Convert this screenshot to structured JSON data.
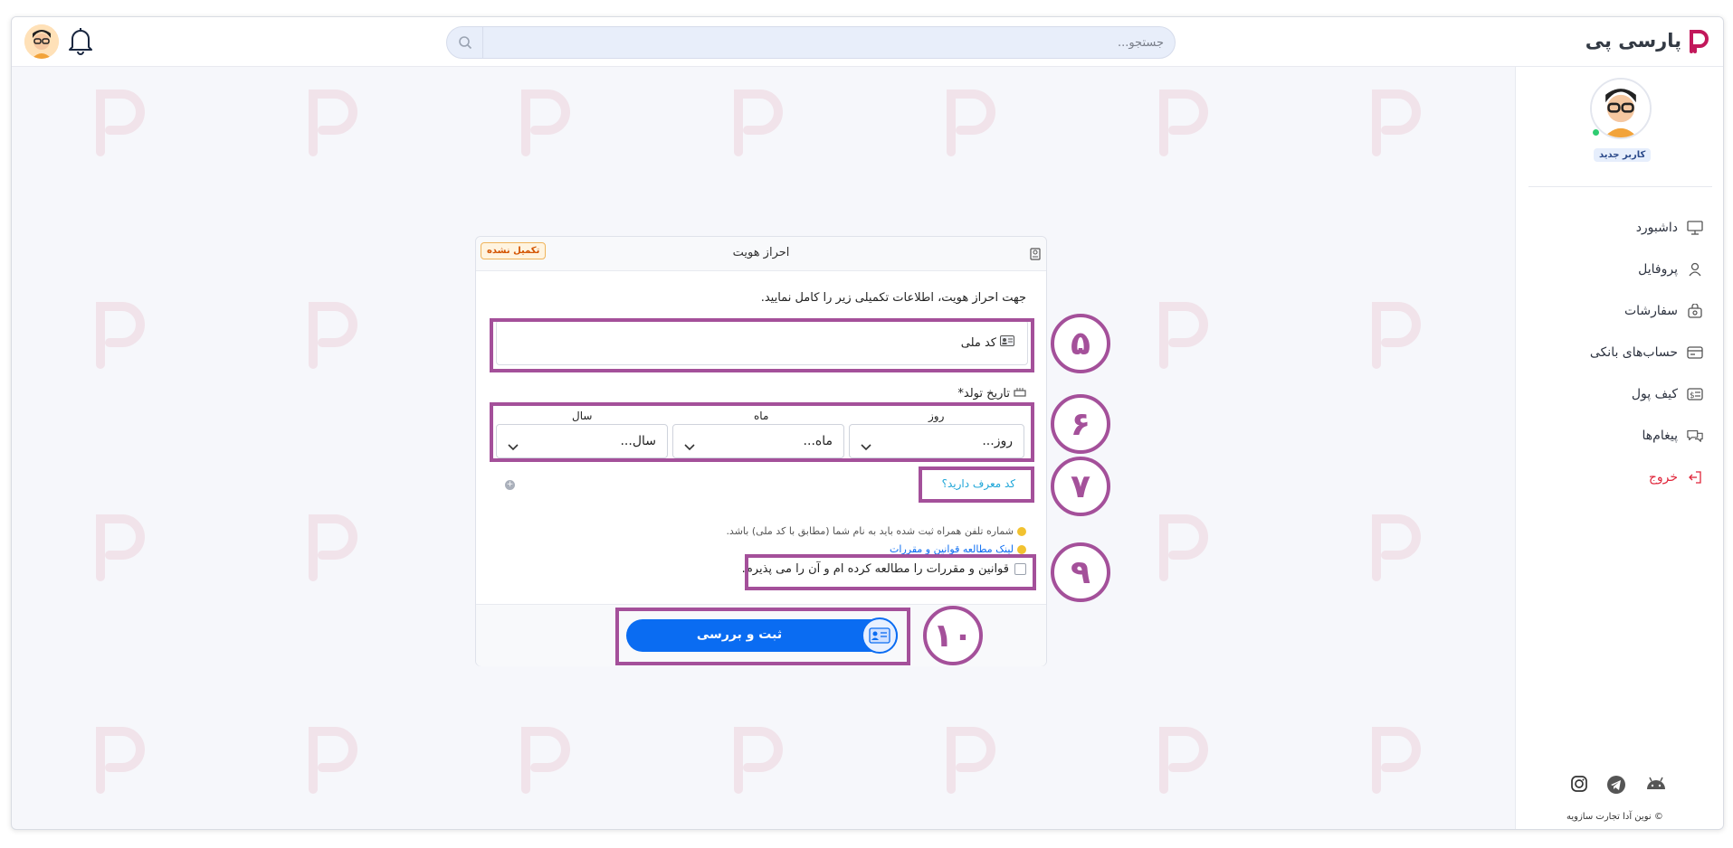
{
  "header": {
    "logo_text": "پارسی پی",
    "search_placeholder": "جستجو..."
  },
  "sidebar": {
    "user_badge": "کاربر جدید",
    "items": [
      {
        "label": "داشبورد",
        "icon": "monitor-icon"
      },
      {
        "label": "پروفایل",
        "icon": "user-icon"
      },
      {
        "label": "سفارشات",
        "icon": "shopping-bag-icon"
      },
      {
        "label": "حساب‌های بانکی",
        "icon": "bank-card-icon"
      },
      {
        "label": "کیف پول",
        "icon": "wallet-icon"
      },
      {
        "label": "پیغام‌ها",
        "icon": "chat-icon"
      },
      {
        "label": "خروج",
        "icon": "logout-icon"
      }
    ],
    "social": [
      "instagram-icon",
      "telegram-icon",
      "android-icon"
    ],
    "copyright": "© نوین آدا تجارت سازویه"
  },
  "card": {
    "title": "احراز هویت",
    "status_badge": "تکمیل نشده",
    "intro": "جهت احراز هویت، اطلاعات تکمیلی زیر را کامل نمایید.",
    "national_code_label": "کد ملی",
    "dob_label": "تاریخ تولد*",
    "day_label": "روز",
    "month_label": "ماه",
    "year_label": "سال",
    "day_value": "روز...",
    "month_value": "ماه...",
    "year_value": "سال...",
    "referral_link": "کد معرف دارید؟",
    "note_phone": "شماره تلفن همراه ثبت شده باید به نام شما (مطابق با کد ملی) باشد.",
    "note_terms_link": "لینک مطالعه قوانین و مقررات",
    "terms_checkbox_label": "قوانین و مقررات را مطالعه کرده ام و آن را می پذیرم.",
    "submit_label": "ثبت و بررسی"
  },
  "annotations": [
    "۵",
    "۶",
    "۷",
    "۹",
    "۱۰"
  ],
  "colors": {
    "accent": "#0a6cf2",
    "annotation": "#a4509a",
    "logout": "#e0253a",
    "link": "#1fa6d8",
    "warning": "#d35400"
  }
}
